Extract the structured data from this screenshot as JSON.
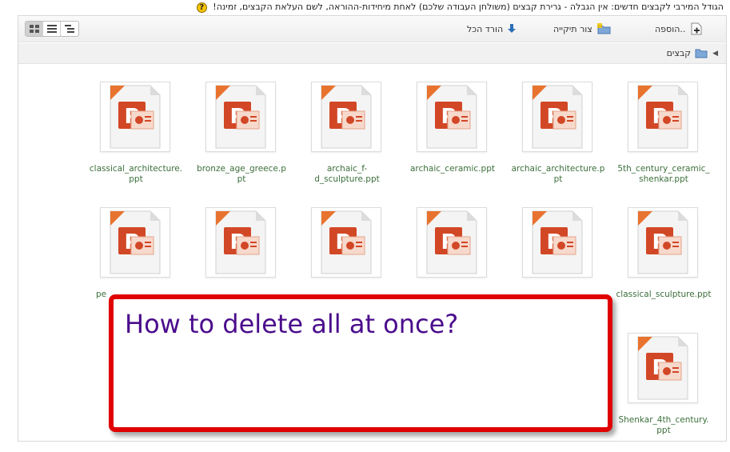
{
  "top_note": {
    "text": "הגודל המירבי לקבצים חדשים: אין הגבלה - גרירת קבצים (משולחן העבודה שלכם) לאחת מיחידות-ההוראה, לשם העלאת הקבצים, זמינה!",
    "icon": "help-icon"
  },
  "toolbar": {
    "add_label": "הוספה..",
    "create_folder_label": "צור תיקייה",
    "download_all_label": "הורד הכל",
    "views": [
      "icons-view",
      "list-view",
      "tree-view"
    ],
    "active_view": "icons-view"
  },
  "path": {
    "current": "קבצים"
  },
  "files": [
    {
      "name": "5th_century_ceramic_shenkar.ppt",
      "display": "5th_century_ceramic_\nshenkar.ppt"
    },
    {
      "name": "archaic_architecture.ppt",
      "display": "archaic_architecture.p\npt"
    },
    {
      "name": "archaic_ceramic.ppt",
      "display": "archaic_ceramic.ppt"
    },
    {
      "name": "archaic_f-d_sculpture.ppt",
      "display": "archaic_f-\nd_sculpture.ppt"
    },
    {
      "name": "bronze_age_greece.ppt",
      "display": "bronze_age_greece.p\npt"
    },
    {
      "name": "classical_architecture.ppt",
      "display": "classical_architecture.\nppt"
    },
    {
      "name": "classical_sculpture.ppt",
      "display": "classical_sculpture.ppt"
    },
    {
      "name": "",
      "display": ""
    },
    {
      "name": "",
      "display": ""
    },
    {
      "name": "",
      "display": ""
    },
    {
      "name": "",
      "display": ""
    },
    {
      "name": "pe",
      "display": "pe"
    },
    {
      "name": "Shenkar_4th_century.ppt",
      "display": "Shenkar_4th_century.\nppt"
    }
  ],
  "callout": {
    "text": "How to delete all at once?"
  },
  "colors": {
    "file_name": "#3b6f3b",
    "callout_border": "#e00000",
    "callout_text": "#4b0d8c",
    "ppt_orange": "#d24726"
  }
}
